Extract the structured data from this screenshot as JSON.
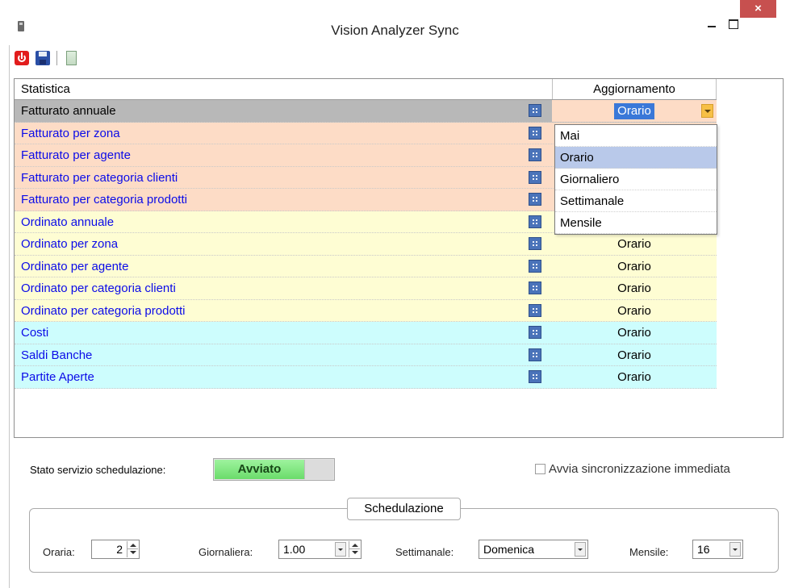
{
  "window": {
    "title": "Vision Analyzer Sync",
    "close_glyph": "×"
  },
  "toolbar": {
    "icons": [
      "power-icon",
      "save-icon",
      "notes-icon"
    ]
  },
  "grid": {
    "headers": {
      "statistica": "Statistica",
      "aggiornamento": "Aggiornamento"
    },
    "selected_row": {
      "name": "Fatturato annuale",
      "value": "Orario"
    },
    "rows": [
      {
        "name": "Fatturato per zona",
        "value": "",
        "color": "#fddcc6"
      },
      {
        "name": "Fatturato per agente",
        "value": "",
        "color": "#fddcc6"
      },
      {
        "name": "Fatturato per categoria clienti",
        "value": "",
        "color": "#fddcc6"
      },
      {
        "name": "Fatturato per categoria prodotti",
        "value": "",
        "color": "#fddcc6"
      },
      {
        "name": "Ordinato annuale",
        "value": "",
        "color": "#fefdd3"
      },
      {
        "name": "Ordinato per zona",
        "value": "Orario",
        "color": "#fefdd3"
      },
      {
        "name": "Ordinato per agente",
        "value": "Orario",
        "color": "#fefdd3"
      },
      {
        "name": "Ordinato per categoria clienti",
        "value": "Orario",
        "color": "#fefdd3"
      },
      {
        "name": "Ordinato per categoria prodotti",
        "value": "Orario",
        "color": "#fefdd3"
      },
      {
        "name": "Costi",
        "value": "Orario",
        "color": "#cdfdfd"
      },
      {
        "name": "Saldi Banche",
        "value": "Orario",
        "color": "#cdfdfd"
      },
      {
        "name": "Partite Aperte",
        "value": "Orario",
        "color": "#cdfdfd"
      }
    ],
    "dropdown_options": [
      "Mai",
      "Orario",
      "Giornaliero",
      "Settimanale",
      "Mensile"
    ],
    "dropdown_active": "Orario"
  },
  "service": {
    "label": "Stato servizio schedulazione:",
    "status": "Avviato",
    "status_color": "#7fe87f"
  },
  "sync_now": {
    "label": "Avvia sincronizzazione immediata",
    "checked": false
  },
  "schedule": {
    "title": "Schedulazione",
    "hourly_label": "Oraria:",
    "hourly_value": "2",
    "daily_label": "Giornaliera:",
    "daily_value": "1.00",
    "weekly_label": "Settimanale:",
    "weekly_value": "Domenica",
    "monthly_label": "Mensile:",
    "monthly_value": "16"
  }
}
